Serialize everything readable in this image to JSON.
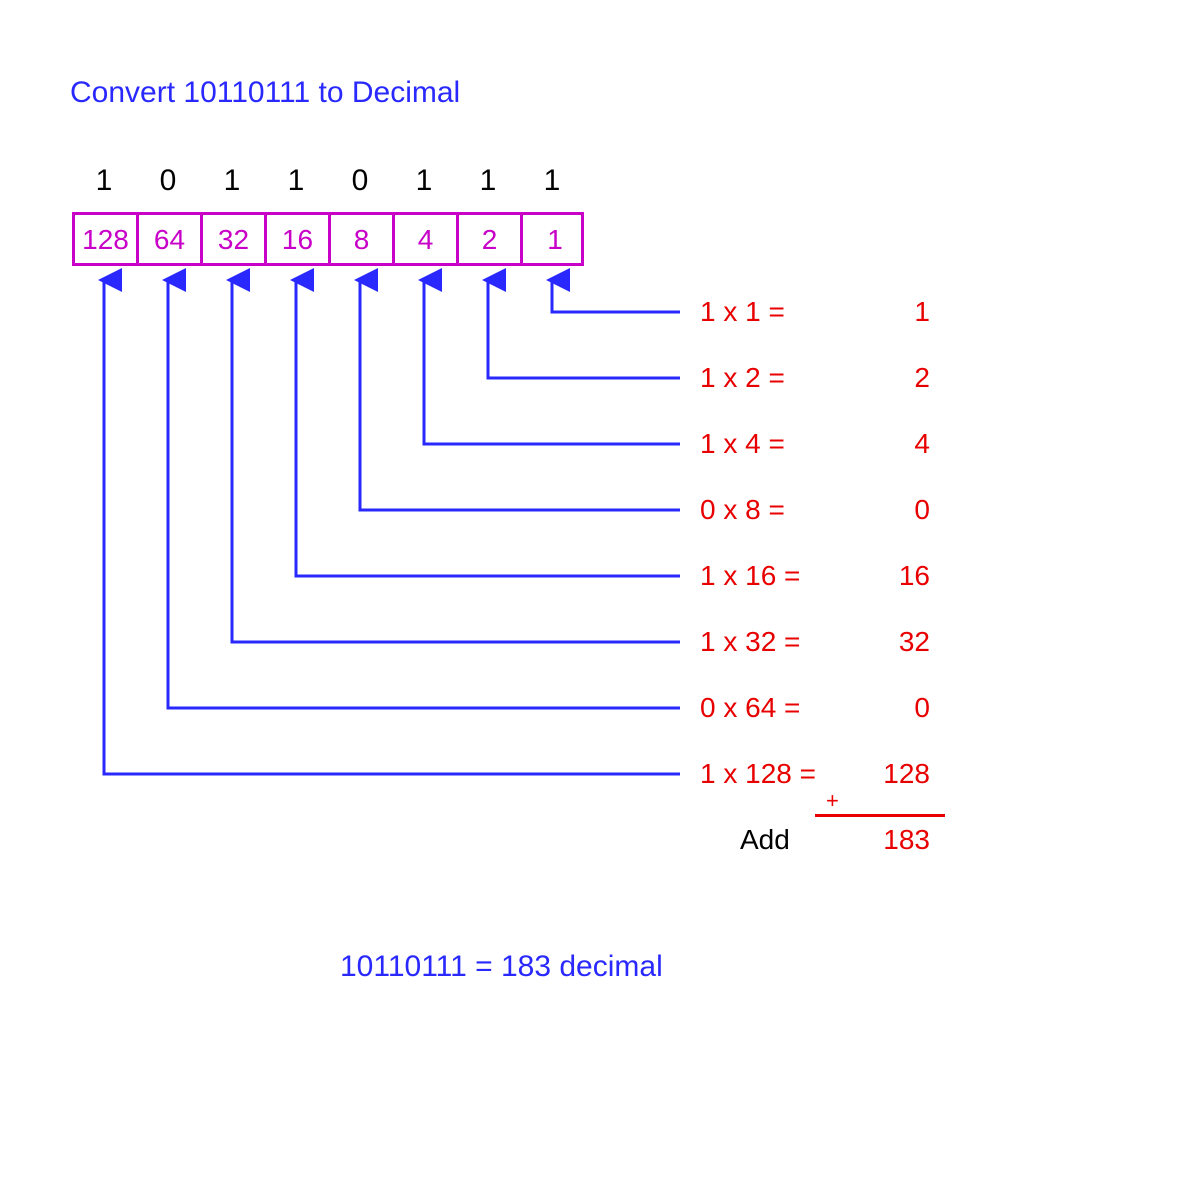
{
  "title": "Convert 10110111 to Decimal",
  "bits": [
    "1",
    "0",
    "1",
    "1",
    "0",
    "1",
    "1",
    "1"
  ],
  "places": [
    "128",
    "64",
    "32",
    "16",
    "8",
    "4",
    "2",
    "1"
  ],
  "rows": [
    {
      "expr": "1 x 1 =",
      "val": "1"
    },
    {
      "expr": "1 x 2 =",
      "val": "2"
    },
    {
      "expr": "1 x 4 =",
      "val": "4"
    },
    {
      "expr": "0 x 8 =",
      "val": "0"
    },
    {
      "expr": "1 x 16 =",
      "val": "16"
    },
    {
      "expr": "1 x 32 =",
      "val": "32"
    },
    {
      "expr": "0 x 64 =",
      "val": "0"
    },
    {
      "expr": "1 x 128 =",
      "val": "128"
    }
  ],
  "add_label": "Add",
  "sum": "183",
  "plus": "+",
  "conclusion": "10110111 = 183 decimal",
  "layout": {
    "tableLeft": 72,
    "tableTop": 212,
    "tableWidth": 512,
    "cellWidth": 64,
    "bitRowTop": 164,
    "arrowTopY": 280,
    "eqLineRight": 680,
    "rowYs": [
      312,
      378,
      444,
      510,
      576,
      642,
      708,
      774
    ]
  }
}
